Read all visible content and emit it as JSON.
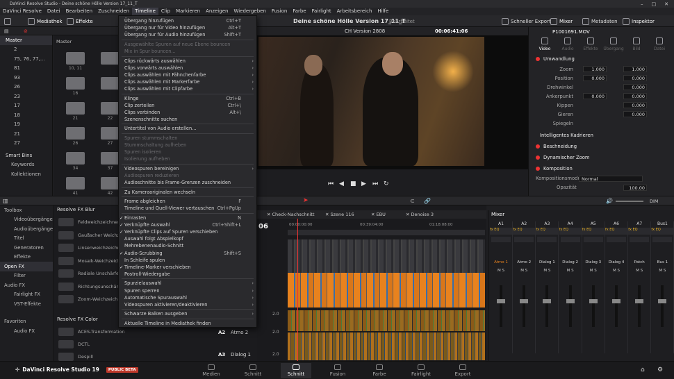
{
  "window": {
    "title": "DaVinci Resolve Studio - Deine schöne Hölle Version 17_11_T"
  },
  "menubar": [
    "DaVinci Resolve",
    "Datei",
    "Bearbeiten",
    "Zuschneiden",
    "Timeline",
    "Clip",
    "Markieren",
    "Anzeigen",
    "Wiedergeben",
    "Fusion",
    "Farbe",
    "Fairlight",
    "Arbeitsbereich",
    "Hilfe"
  ],
  "toolbar": {
    "media_pool": "Mediathek",
    "effects": "Effekte",
    "project_title": "Deine schöne Hölle Version 17_11_T",
    "edited": "Bearbeitet",
    "quick_export": "Schneller Export",
    "mixer": "Mixer",
    "metadata": "Metadaten",
    "inspector": "Inspektor"
  },
  "media": {
    "master_header": "Master",
    "pool_header": "Master"
  },
  "bins": [
    "Master",
    "2",
    "75, 76, 77,...",
    "81",
    "93",
    "26",
    "23",
    "17",
    "18",
    "19",
    "21",
    "27"
  ],
  "folders": [
    "10, 11",
    "",
    "16",
    "",
    "21",
    "22",
    "26",
    "27",
    "34",
    "37",
    "41",
    "42"
  ],
  "smart_bins": {
    "title": "Smart Bins",
    "items": [
      "Keywords",
      "Kollektionen"
    ]
  },
  "timeline_menu": [
    {
      "label": "Übergang hinzufügen",
      "sc": "Ctrl+T"
    },
    {
      "label": "Übergang nur für Video hinzufügen",
      "sc": "Alt+T"
    },
    {
      "label": "Übergang nur für Audio hinzufügen",
      "sc": "Shift+T"
    },
    {
      "sep": true
    },
    {
      "label": "Ausgewählte Spuren auf neue Ebene bouncen",
      "dis": true
    },
    {
      "label": "Mix in Spur bouncen...",
      "dis": true
    },
    {
      "sep": true
    },
    {
      "label": "Clips rückwärts auswählen",
      "ar": true
    },
    {
      "label": "Clips vorwärts auswählen",
      "ar": true
    },
    {
      "label": "Clips auswählen mit Fähnchenfarbe",
      "ar": true
    },
    {
      "label": "Clips auswählen mit Markerfarbe",
      "ar": true
    },
    {
      "label": "Clips auswählen mit Clipfarbe",
      "ar": true
    },
    {
      "sep": true
    },
    {
      "label": "Klinge",
      "sc": "Ctrl+B"
    },
    {
      "label": "Clip zerteilen",
      "sc": "Ctrl+\\"
    },
    {
      "label": "Clips verbinden",
      "sc": "Alt+\\"
    },
    {
      "label": "Szenenschnitte suchen"
    },
    {
      "sep": true
    },
    {
      "label": "Untertitel von Audio erstellen..."
    },
    {
      "sep": true
    },
    {
      "label": "Spuren stummschalten",
      "dis": true
    },
    {
      "label": "Stummschaltung aufheben",
      "dis": true
    },
    {
      "label": "Spuren isolieren",
      "dis": true
    },
    {
      "label": "Isolierung aufheben",
      "dis": true
    },
    {
      "sep": true
    },
    {
      "label": "Videospuren bereinigen",
      "ar": true
    },
    {
      "label": "Audiospuren reduzieren",
      "dis": true
    },
    {
      "label": "Audioschnitte bis Frame-Grenzen zuschneiden"
    },
    {
      "sep": true
    },
    {
      "label": "Zu Kameraoriginalen wechseln"
    },
    {
      "sep": true
    },
    {
      "label": "Frame abgleichen",
      "sc": "F"
    },
    {
      "label": "Timeline und Quell-Viewer vertauschen",
      "sc": "Ctrl+PgUp"
    },
    {
      "sep": true
    },
    {
      "label": "Einrasten",
      "sc": "N",
      "ck": true
    },
    {
      "label": "Verknüpfte Auswahl",
      "sc": "Ctrl+Shift+L",
      "ck": true
    },
    {
      "label": "Verknüpfte Clips auf Spuren verschieben",
      "ck": true
    },
    {
      "label": "Auswahl folgt Abspielkopf"
    },
    {
      "label": "Mehrebenenaudio-Schnitt"
    },
    {
      "label": "Audio-Scrubbing",
      "sc": "Shift+S",
      "ck": true
    },
    {
      "label": "In Schleife spulen"
    },
    {
      "label": "Timeline-Marker verschieben",
      "ck": true
    },
    {
      "label": "Postroll-Wiedergabe"
    },
    {
      "sep": true
    },
    {
      "label": "Spurzielauswahl",
      "ar": true
    },
    {
      "label": "Spuren sperren",
      "ar": true
    },
    {
      "label": "Automatische Spurauswahl",
      "ar": true
    },
    {
      "label": "Videospuren aktivieren/deaktivieren",
      "ar": true
    },
    {
      "sep": true
    },
    {
      "label": "Schwarze Balken ausgeben",
      "ar": true
    },
    {
      "sep": true
    },
    {
      "label": "Aktuelle Timeline in Mediathek finden"
    }
  ],
  "viewer": {
    "version": "CH Version 2808",
    "timecode": "00:06:41:06"
  },
  "inspector": {
    "clip": "P1001691.MOV",
    "tabs": [
      "Video",
      "Audio",
      "Effekte",
      "Übergang",
      "Bild",
      "Datei"
    ],
    "transform": "Umwandlung",
    "zoom": "Zoom",
    "position": "Position",
    "rotation": "Drehwinkel",
    "anchor": "Ankerpunkt",
    "pitch": "Kippen",
    "yaw": "Gieren",
    "flip": "Spiegeln",
    "zoom_x": "1.000",
    "zoom_y": "1.000",
    "pos_x": "0.000",
    "pos_y": "0.000",
    "rot": "0.000",
    "anc_x": "0.000",
    "anc_y": "0.000",
    "pitch_v": "0.000",
    "yaw_v": "0.000",
    "smart_reframe": "Intelligentes Kadrieren",
    "crop": "Beschneidung",
    "dyn_zoom": "Dynamischer Zoom",
    "composite": "Komposition",
    "comp_mode": "Kompositionsmodus",
    "comp_val": "Normal",
    "opacity": "Opazität",
    "opacity_val": "100.00"
  },
  "fx": {
    "toolbox": "Toolbox",
    "video_tr": "Videoübergänge",
    "audio_tr": "Audioübergänge",
    "titles": "Titel",
    "generators": "Generatoren",
    "effects": "Effekte",
    "openfx": "Open FX",
    "filter": "Filter",
    "audiofx": "Audio FX",
    "fairlight_fx": "Fairlight FX",
    "vst": "VST-Effekte",
    "favorites": "Favoriten",
    "fav_audio": "Audio FX",
    "blur_header": "Resolve FX Blur",
    "color_header": "Resolve FX Color",
    "blur_items": [
      "Feldweichzeichner",
      "Gaußscher Weichz.",
      "Linsenweichzeichn.",
      "Mosaik-Weichzeich.",
      "Radiale Unschärfe",
      "Richtungsunschärfe",
      "Zoom-Weichzeich."
    ],
    "color_items": [
      "ACES-Transformation",
      "DCTL",
      "Despill"
    ]
  },
  "timeline": {
    "tc": "06",
    "tabs": [
      "Check-Nachschnitt",
      "Szene 116",
      "EBU",
      "Denoise 3"
    ],
    "ruler": [
      "00:00:00:00",
      "00:39:04:00",
      "01:18:08:00"
    ],
    "tracks": [
      {
        "id": "A2",
        "name": "Atmo 2",
        "fx": "2.0"
      },
      {
        "id": "A3",
        "name": "Dialog 1",
        "fx": "2.0"
      }
    ],
    "fxval": "2.0"
  },
  "mixer": {
    "title": "Mixer",
    "channels": [
      "A1",
      "A2",
      "A3",
      "A4",
      "A5",
      "A6",
      "A7",
      "Bus1"
    ],
    "names": [
      "Atmo 1",
      "Atmo 2",
      "Dialog 1",
      "Dialog 2",
      "Dialog 3",
      "Dialog 4",
      "Patch",
      "Bus 1"
    ]
  },
  "audio": {
    "dim": "DIM"
  },
  "pages": [
    "Medien",
    "Schnitt",
    "Schnitt",
    "Fusion",
    "Farbe",
    "Fairlight",
    "Export"
  ],
  "branding": {
    "app": "DaVinci Resolve Studio 19",
    "badge": "PUBLIC BETA"
  },
  "colors": {
    "orange": "#e8821e",
    "accent": "#3a8ee6",
    "red": "#e33"
  }
}
